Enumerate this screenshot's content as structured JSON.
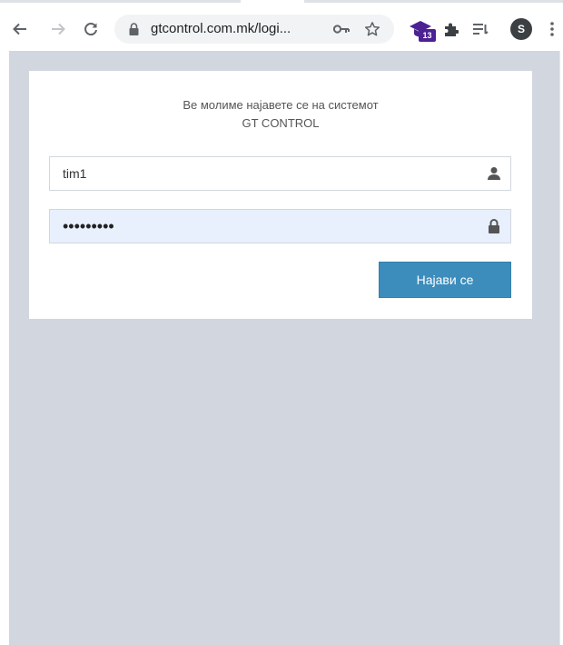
{
  "browser": {
    "url": "gtcontrol.com.mk/logi...",
    "extension_badge": "13",
    "profile_initial": "S"
  },
  "login": {
    "message_line1": "Ве молиме најавете се на системот",
    "message_line2": "GT CONTROL",
    "username_value": "tim1",
    "password_value": "•••••••••",
    "submit_label": "Најави се"
  },
  "colors": {
    "page_background": "#d2d6de",
    "button": "#3c8dbc",
    "autofill": "#e8f0fe"
  }
}
